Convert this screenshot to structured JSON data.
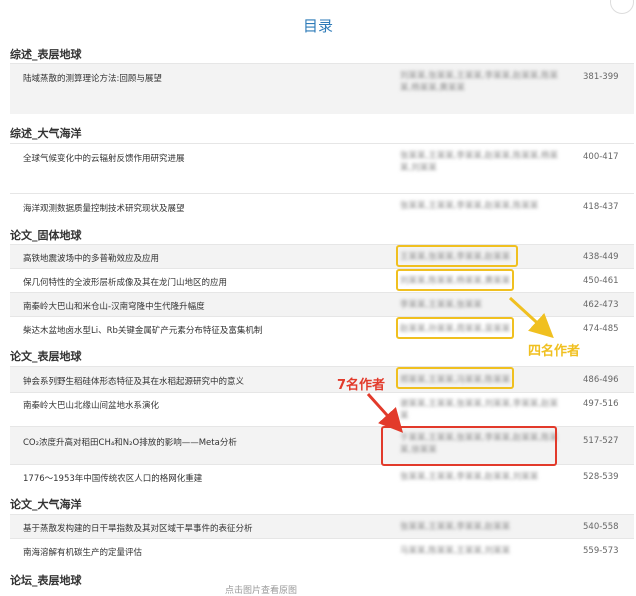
{
  "page_title": "目录",
  "sections": [
    {
      "id": "s1",
      "label": "综述_表层地球"
    },
    {
      "id": "s2",
      "label": "综述_大气海洋"
    },
    {
      "id": "s3",
      "label": "论文_固体地球"
    },
    {
      "id": "s4",
      "label": "论文_表层地球"
    },
    {
      "id": "s5",
      "label": "论文_大气海洋"
    },
    {
      "id": "s6",
      "label": "论坛_表层地球"
    }
  ],
  "articles": [
    {
      "title": "陆域蒸散的测算理论方法:回顾与展望",
      "authors": "刘某某,张某某,王某某,李某某,赵某某,陈某某,杨某某,黄某某",
      "pages": "381-399"
    },
    {
      "title": "全球气候变化中的云辐射反馈作用研究进展",
      "authors": "张某某,王某某,李某某,赵某某,陈某某,杨某某,刘某某",
      "pages": "400-417"
    },
    {
      "title": "海洋观测数据质量控制技术研究现状及展望",
      "authors": "张某某,王某某,李某某,赵某某,陈某某",
      "pages": "418-437"
    },
    {
      "title": "高铁地震波场中的多普勒效应及应用",
      "authors": "王某某,张某某,李某某,赵某某",
      "pages": "438-449"
    },
    {
      "title": "保几何特性的全波形层析成像及其在龙门山地区的应用",
      "authors": "刘某某,陈某某,杨某某,黄某某",
      "pages": "450-461"
    },
    {
      "title": "南秦岭大巴山和米仓山-汉南穹隆中生代隆升幅度",
      "authors": "李某某,王某某,张某某",
      "pages": "462-473"
    },
    {
      "title": "柴达木盆地卤水型Li、Rb关键金属矿产元素分布特征及富集机制",
      "authors": "赵某某,孙某某,周某某,吴某某",
      "pages": "474-485"
    },
    {
      "title": "钟会系列野生稻硅体形态特征及其在水稻起源研究中的意义",
      "authors": "郑某某,王某某,冯某某,陈某某",
      "pages": "486-496"
    },
    {
      "title": "南秦岭大巴山北缘山间盆地水系演化",
      "authors": "谢某某,王某某,张某某,刘某某,李某某,赵某某",
      "pages": "497-516"
    },
    {
      "title": "CO₂浓度升高对稻田CH₄和N₂O排放的影响——Meta分析",
      "authors": "于某某,王某某,张某某,李某某,赵某某,陈某某,徐某某",
      "pages": "517-527"
    },
    {
      "title": "1776～1953年中国传统农区人口的格网化重建",
      "authors": "张某某,王某某,李某某,赵某某,刘某某",
      "pages": "528-539"
    },
    {
      "title": "基于蒸散发构建的日干旱指数及其对区域干旱事件的表征分析",
      "authors": "张某某,王某某,李某某,赵某某",
      "pages": "540-558"
    },
    {
      "title": "南海溶解有机碳生产的定量评估",
      "authors": "马某某,陈某某,王某某,刘某某",
      "pages": "559-573"
    }
  ],
  "annotations": {
    "four_authors_label": "四名作者",
    "seven_authors_label": "7名作者",
    "four_color": "#f0c020",
    "seven_color": "#e23a2b"
  },
  "footer_text": "点击图片查看原图"
}
